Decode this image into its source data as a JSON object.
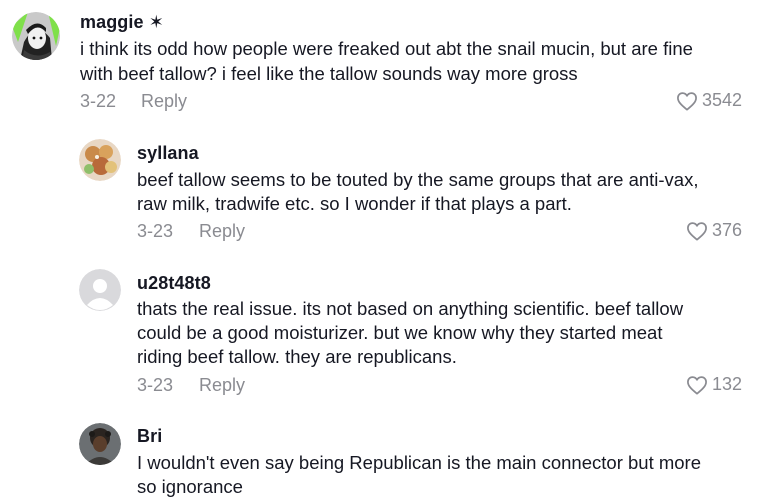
{
  "comments": [
    {
      "username": "maggie ✶",
      "lines": [
        "i think its odd how people were freaked out abt the snail mucin, but are fine",
        "with beef tallow? i feel like the tallow sounds way more gross"
      ],
      "date": "3-22",
      "reply_label": "Reply",
      "likes": "3542"
    },
    {
      "username": "syllana",
      "lines": [
        "beef tallow seems to be touted by the same groups that are anti-vax,",
        "raw milk, tradwife etc. so I wonder if that plays a part."
      ],
      "date": "3-23",
      "reply_label": "Reply",
      "likes": "376"
    },
    {
      "username": "u28t48t8",
      "lines": [
        "thats the real issue. its not based on anything scientific. beef tallow",
        "could be a good moisturizer. but we know why they started meat",
        "riding beef tallow. they are republicans."
      ],
      "date": "3-23",
      "reply_label": "Reply",
      "likes": "132"
    },
    {
      "username": "Bri",
      "lines": [
        "I wouldn't even say being Republican is the main connector but more",
        "so ignorance"
      ]
    }
  ],
  "icons": {
    "like": "heart-outline-icon"
  },
  "colors": {
    "text": "#161823",
    "muted": "#8a8b91",
    "accent_green": "#7fe04a"
  }
}
